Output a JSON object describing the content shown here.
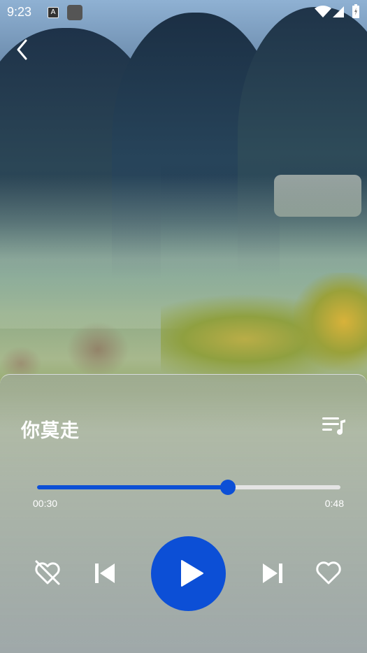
{
  "status_bar": {
    "time": "9:23",
    "icons": [
      "app-a-icon",
      "app-square-icon",
      "wifi-icon",
      "signal-icon",
      "battery-icon"
    ]
  },
  "nav": {
    "back_icon": "back-chevron-icon"
  },
  "player": {
    "song_title": "你莫走",
    "playlist_icon": "playlist-icon",
    "progress": {
      "current_time": "00:30",
      "total_time": "0:48",
      "fraction": 0.63
    },
    "controls": {
      "dislike_icon": "broken-heart-icon",
      "previous_icon": "skip-previous-icon",
      "play_icon": "play-icon",
      "next_icon": "skip-next-icon",
      "like_icon": "heart-outline-icon"
    },
    "accent_color": "#0c4fd6"
  }
}
